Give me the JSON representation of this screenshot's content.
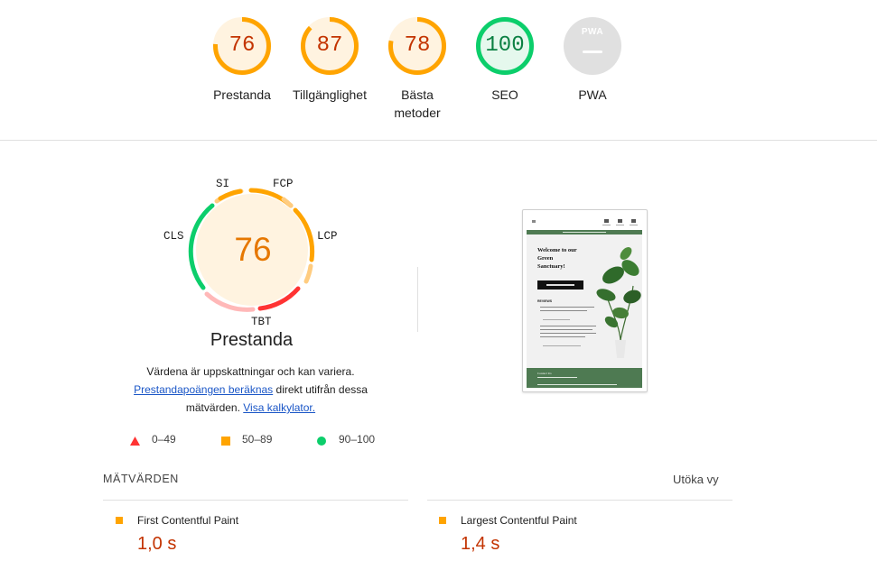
{
  "categories": [
    {
      "label": "Prestanda",
      "score": "76",
      "rating": "average"
    },
    {
      "label": "Tillgänglighet",
      "score": "87",
      "rating": "average"
    },
    {
      "label": "Bästa metoder",
      "score": "78",
      "rating": "average"
    },
    {
      "label": "SEO",
      "score": "100",
      "rating": "pass"
    },
    {
      "label": "PWA",
      "score": "",
      "rating": "na",
      "badge": "PWA"
    }
  ],
  "performance": {
    "score": "76",
    "title": "Prestanda",
    "metric_labels": {
      "si": "SI",
      "fcp": "FCP",
      "lcp": "LCP",
      "tbt": "TBT",
      "cls": "CLS"
    },
    "description": {
      "line1": "Värdena är uppskattningar och kan variera.",
      "link1": "Prestandapoängen beräknas",
      "line2_rest": "direkt utifrån dessa",
      "line3_prefix": "mätvärden.",
      "link2": "Visa kalkylator."
    },
    "legend": [
      {
        "range": "0–49",
        "shape": "triangle",
        "color": "#ff3333"
      },
      {
        "range": "50–89",
        "shape": "square",
        "color": "#ffa400"
      },
      {
        "range": "90–100",
        "shape": "circle",
        "color": "#0cce6b"
      }
    ]
  },
  "metrics": {
    "heading": "MÄTVÄRDEN",
    "expand_label": "Utöka vy",
    "items": [
      {
        "name": "First Contentful Paint",
        "value": "1,0 s",
        "rating": "average"
      },
      {
        "name": "Largest Contentful Paint",
        "value": "1,4 s",
        "rating": "average"
      }
    ]
  },
  "colors": {
    "average": "#ffa400",
    "average_text": "#c33300",
    "pass": "#0cce6b",
    "pass_text": "#0b8043",
    "fail": "#ff3333",
    "na": "#9e9e9e"
  },
  "screenshot_preview": {
    "announcement": "Free delivery on orders over $40",
    "hero_title": "Welcome to our Green Sanctuary!",
    "cta": "SHOP NOW!",
    "reviews_heading": "REVIEWS",
    "footer_title": "Contact Us"
  }
}
